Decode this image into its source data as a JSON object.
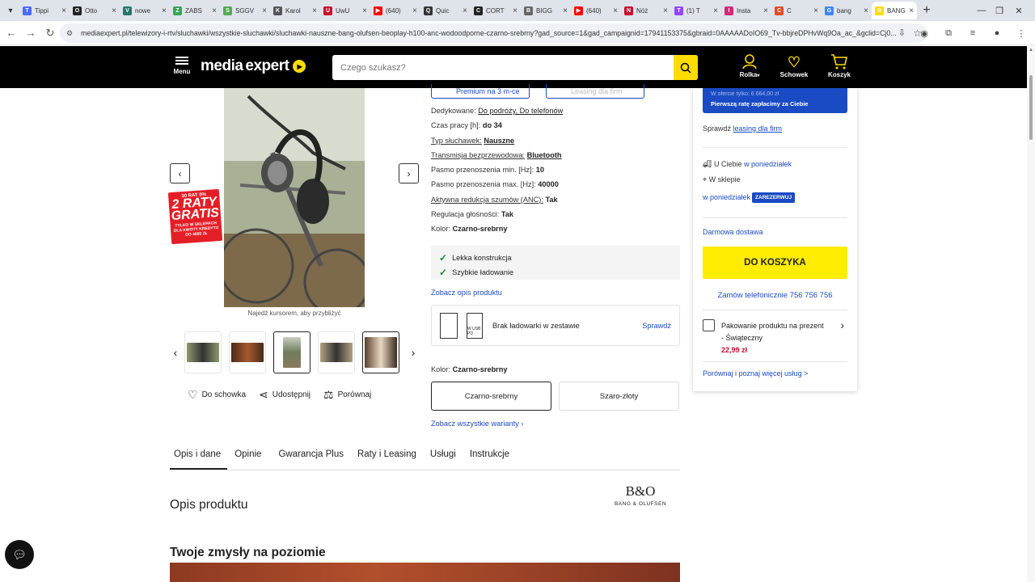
{
  "browser": {
    "tabs": [
      {
        "title": "Tippi",
        "fav": "T",
        "color": "#4a6cf7"
      },
      {
        "title": "Otto",
        "fav": "O",
        "color": "#222222"
      },
      {
        "title": "nowe",
        "fav": "V",
        "color": "#1f7a6a"
      },
      {
        "title": "ZABS",
        "fav": "Z",
        "color": "#3aa35a"
      },
      {
        "title": "SGGV",
        "fav": "S",
        "color": "#58a858"
      },
      {
        "title": "Karol",
        "fav": "K",
        "color": "#555555"
      },
      {
        "title": "UwU",
        "fav": "U",
        "color": "#c8102e"
      },
      {
        "title": "(640)",
        "fav": "▶",
        "color": "#ff0000"
      },
      {
        "title": "Quic",
        "fav": "Q",
        "color": "#333333"
      },
      {
        "title": "CORT",
        "fav": "C",
        "color": "#222222"
      },
      {
        "title": "BIGG",
        "fav": "B",
        "color": "#666666"
      },
      {
        "title": "(640)",
        "fav": "▶",
        "color": "#ff0000"
      },
      {
        "title": "Nóż",
        "fav": "N",
        "color": "#c8102e"
      },
      {
        "title": "(1) T",
        "fav": "T",
        "color": "#9146ff"
      },
      {
        "title": "Insta",
        "fav": "I",
        "color": "#d62976"
      },
      {
        "title": "C",
        "fav": "C",
        "color": "#e34c26"
      },
      {
        "title": "bang",
        "fav": "G",
        "color": "#4285f4"
      },
      {
        "title": "BANG",
        "fav": "B",
        "color": "#ffdc00"
      }
    ],
    "url": "mediaexpert.pl/telewizory-i-rtv/sluchawki/wszystkie-sluchawki/sluchawki-nauszne-bang-olufsen-beoplay-h100-anc-wodoodporne-czarno-srebrny?gad_source=1&gad_campaignid=17941153375&gbraid=0AAAAADoIO69_Tv-bbjreDPHvWq9Oa_ac_&gclid=Cj0..."
  },
  "header": {
    "menu_label": "Menu",
    "logo_part1": "media",
    "logo_part2": "expert",
    "search_placeholder": "Czego szukasz?",
    "account_label": "Rolka",
    "wishlist_label": "Schowek",
    "cart_label": "Koszyk"
  },
  "gallery": {
    "promo_line1": "0% RRSO 0%",
    "promo_big1": "2 RATY",
    "promo_big2": "GRATIS",
    "promo_small": "TYLKO W SKLEPACH DLA KWOTY KREDYTU DO 4000 ZŁ",
    "promo_num": "30 RAT 0%",
    "zoom_hint": "Najedź kursorem, aby przybliżyć",
    "actions": {
      "save": "Do schowka",
      "share": "Udostępnij",
      "compare": "Porównaj"
    }
  },
  "top_buttons": {
    "premium": "Premium na 3 m-ce",
    "leasing": "Leasing dla firm"
  },
  "specs": [
    {
      "key": "Dedykowane:",
      "value": "Do podróży, Do telefonów",
      "key_u": false,
      "val_u": true
    },
    {
      "key": "Czas pracy [h]:",
      "value": "do 34",
      "key_u": false,
      "val_u": false
    },
    {
      "key": "Typ słuchawek:",
      "value": "Nauszne",
      "key_u": true,
      "val_u": true
    },
    {
      "key": "Transmisja bezprzewodowa:",
      "value": "Bluetooth",
      "key_u": true,
      "val_u": true
    },
    {
      "key": "Pasmo przenoszenia min. [Hz]:",
      "value": "10",
      "key_u": false,
      "val_u": false
    },
    {
      "key": "Pasmo przenoszenia max. [Hz]:",
      "value": "40000",
      "key_u": false,
      "val_u": false
    },
    {
      "key": "Aktywna redukcja szumów (ANC):",
      "value": "Tak",
      "key_u": true,
      "val_u": false
    },
    {
      "key": "Regulacja głośności:",
      "value": "Tak",
      "key_u": false,
      "val_u": false
    },
    {
      "key": "Kolor:",
      "value": "Czarno-srebrny",
      "key_u": false,
      "val_u": false
    }
  ],
  "features": [
    "Lekka konstrukcja",
    "Szybkie ładowanie"
  ],
  "desc_link": "Zobacz opis produktu",
  "charger": {
    "text": "Brak ładowarki w zestawie",
    "link": "Sprawdź",
    "icon_label": "W USB PD"
  },
  "color": {
    "label": "Kolor:",
    "value": "Czarno-srebrny",
    "options": [
      "Czarno-srebrny",
      "Szaro-złoty"
    ]
  },
  "variants_link": "Zobacz wszystkie warianty",
  "panel": {
    "blue_dim": "W ofercie tylko: 6 664,00 zł",
    "blue_main": "Pierwszą ratę zapłacimy za Ciebie",
    "leasing_prefix": "Sprawdź",
    "leasing_link": "leasing dla firm",
    "delivery_you": "U Ciebie",
    "delivery_you_link": "w poniedziałek",
    "in_store": "W sklepie",
    "in_store_link": "w poniedziałek",
    "reserve": "ZAREZERWUJ",
    "free_delivery": "Darmowa dostawa",
    "cart_button": "DO KOSZYKA",
    "phone_order": "Zamów telefonicznie 756 756 756",
    "gift_text": "Pakowanie produktu na prezent - Świąteczny",
    "gift_price": "22,99 zł",
    "compare_link": "Porównaj i poznaj więcej usług >"
  },
  "tabs": [
    "Opis i dane",
    "Opinie",
    "Gwarancja Plus",
    "Raty i Leasing",
    "Usługi",
    "Instrukcje"
  ],
  "desc": {
    "heading": "Opis produktu",
    "brand_mark": "B&O",
    "brand_name": "BANG & OLUFSEN",
    "subheading": "Twoje zmysły na poziomie"
  },
  "colors": {
    "brand_yellow": "#ffdc00",
    "link_blue": "#1a4bc4",
    "price_red": "#c8102e"
  }
}
